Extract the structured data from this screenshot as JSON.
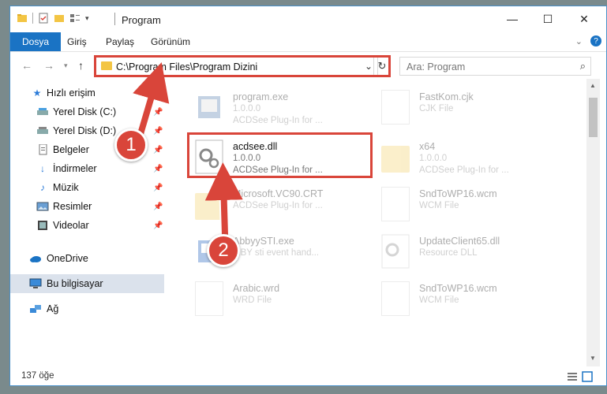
{
  "window": {
    "title": "Program"
  },
  "ribbon": {
    "tabs": [
      "Dosya",
      "Giriş",
      "Paylaş",
      "Görünüm"
    ]
  },
  "address": {
    "path": "C:\\Program Files\\Program Dizini",
    "search_placeholder": "Ara: Program"
  },
  "nav": {
    "items": [
      {
        "label": "Hızlı erişim",
        "icon": "star-icon"
      },
      {
        "label": "Yerel Disk (C:)",
        "icon": "drive-icon"
      },
      {
        "label": "Yerel Disk (D:)",
        "icon": "drive-icon"
      },
      {
        "label": "Belgeler",
        "icon": "documents-icon"
      },
      {
        "label": "İndirmeler",
        "icon": "download-icon"
      },
      {
        "label": "Müzik",
        "icon": "music-icon"
      },
      {
        "label": "Resimler",
        "icon": "pictures-icon"
      },
      {
        "label": "Videolar",
        "icon": "videos-icon"
      },
      {
        "label": "OneDrive",
        "icon": "cloud-icon"
      },
      {
        "label": "Bu bilgisayar",
        "icon": "computer-icon"
      },
      {
        "label": "Ağ",
        "icon": "network-icon"
      }
    ]
  },
  "files": [
    {
      "name": "program.exe",
      "line1": "1.0.0.0",
      "line2": "ACDSee Plug-In for ..."
    },
    {
      "name": "FastKom.cjk",
      "line1": "CJK File",
      "line2": ""
    },
    {
      "name": "acdsee.dll",
      "line1": "1.0.0.0",
      "line2": "ACDSee Plug-In for ..."
    },
    {
      "name": "x64",
      "line1": "1.0.0.0",
      "line2": "ACDSee Plug-In for ..."
    },
    {
      "name": "Microsoft.VC90.CRT",
      "line1": "",
      "line2": "ACDSee Plug-In for ..."
    },
    {
      "name": "SndToWP16.wcm",
      "line1": "WCM File",
      "line2": ""
    },
    {
      "name": "AbbyySTI.exe",
      "line1": "",
      "line2": "...BY sti event hand..."
    },
    {
      "name": "UpdateClient65.dll",
      "line1": "Resource DLL",
      "line2": ""
    },
    {
      "name": "Arabic.wrd",
      "line1": "WRD File",
      "line2": ""
    },
    {
      "name": "SndToWP16.wcm",
      "line1": "WCM File",
      "line2": ""
    }
  ],
  "status": {
    "count": "137 öğe"
  },
  "callouts": [
    "1",
    "2"
  ]
}
